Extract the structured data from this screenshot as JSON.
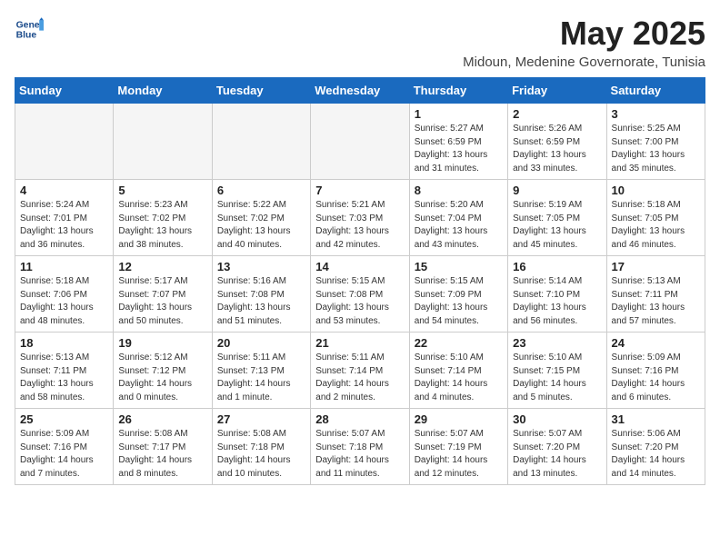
{
  "header": {
    "logo_line1": "General",
    "logo_line2": "Blue",
    "month": "May 2025",
    "location": "Midoun, Medenine Governorate, Tunisia"
  },
  "weekdays": [
    "Sunday",
    "Monday",
    "Tuesday",
    "Wednesday",
    "Thursday",
    "Friday",
    "Saturday"
  ],
  "rows": [
    [
      {
        "day": "",
        "info": "",
        "empty": true
      },
      {
        "day": "",
        "info": "",
        "empty": true
      },
      {
        "day": "",
        "info": "",
        "empty": true
      },
      {
        "day": "",
        "info": "",
        "empty": true
      },
      {
        "day": "1",
        "info": "Sunrise: 5:27 AM\nSunset: 6:59 PM\nDaylight: 13 hours\nand 31 minutes.",
        "empty": false
      },
      {
        "day": "2",
        "info": "Sunrise: 5:26 AM\nSunset: 6:59 PM\nDaylight: 13 hours\nand 33 minutes.",
        "empty": false
      },
      {
        "day": "3",
        "info": "Sunrise: 5:25 AM\nSunset: 7:00 PM\nDaylight: 13 hours\nand 35 minutes.",
        "empty": false
      }
    ],
    [
      {
        "day": "4",
        "info": "Sunrise: 5:24 AM\nSunset: 7:01 PM\nDaylight: 13 hours\nand 36 minutes.",
        "empty": false
      },
      {
        "day": "5",
        "info": "Sunrise: 5:23 AM\nSunset: 7:02 PM\nDaylight: 13 hours\nand 38 minutes.",
        "empty": false
      },
      {
        "day": "6",
        "info": "Sunrise: 5:22 AM\nSunset: 7:02 PM\nDaylight: 13 hours\nand 40 minutes.",
        "empty": false
      },
      {
        "day": "7",
        "info": "Sunrise: 5:21 AM\nSunset: 7:03 PM\nDaylight: 13 hours\nand 42 minutes.",
        "empty": false
      },
      {
        "day": "8",
        "info": "Sunrise: 5:20 AM\nSunset: 7:04 PM\nDaylight: 13 hours\nand 43 minutes.",
        "empty": false
      },
      {
        "day": "9",
        "info": "Sunrise: 5:19 AM\nSunset: 7:05 PM\nDaylight: 13 hours\nand 45 minutes.",
        "empty": false
      },
      {
        "day": "10",
        "info": "Sunrise: 5:18 AM\nSunset: 7:05 PM\nDaylight: 13 hours\nand 46 minutes.",
        "empty": false
      }
    ],
    [
      {
        "day": "11",
        "info": "Sunrise: 5:18 AM\nSunset: 7:06 PM\nDaylight: 13 hours\nand 48 minutes.",
        "empty": false
      },
      {
        "day": "12",
        "info": "Sunrise: 5:17 AM\nSunset: 7:07 PM\nDaylight: 13 hours\nand 50 minutes.",
        "empty": false
      },
      {
        "day": "13",
        "info": "Sunrise: 5:16 AM\nSunset: 7:08 PM\nDaylight: 13 hours\nand 51 minutes.",
        "empty": false
      },
      {
        "day": "14",
        "info": "Sunrise: 5:15 AM\nSunset: 7:08 PM\nDaylight: 13 hours\nand 53 minutes.",
        "empty": false
      },
      {
        "day": "15",
        "info": "Sunrise: 5:15 AM\nSunset: 7:09 PM\nDaylight: 13 hours\nand 54 minutes.",
        "empty": false
      },
      {
        "day": "16",
        "info": "Sunrise: 5:14 AM\nSunset: 7:10 PM\nDaylight: 13 hours\nand 56 minutes.",
        "empty": false
      },
      {
        "day": "17",
        "info": "Sunrise: 5:13 AM\nSunset: 7:11 PM\nDaylight: 13 hours\nand 57 minutes.",
        "empty": false
      }
    ],
    [
      {
        "day": "18",
        "info": "Sunrise: 5:13 AM\nSunset: 7:11 PM\nDaylight: 13 hours\nand 58 minutes.",
        "empty": false
      },
      {
        "day": "19",
        "info": "Sunrise: 5:12 AM\nSunset: 7:12 PM\nDaylight: 14 hours\nand 0 minutes.",
        "empty": false
      },
      {
        "day": "20",
        "info": "Sunrise: 5:11 AM\nSunset: 7:13 PM\nDaylight: 14 hours\nand 1 minute.",
        "empty": false
      },
      {
        "day": "21",
        "info": "Sunrise: 5:11 AM\nSunset: 7:14 PM\nDaylight: 14 hours\nand 2 minutes.",
        "empty": false
      },
      {
        "day": "22",
        "info": "Sunrise: 5:10 AM\nSunset: 7:14 PM\nDaylight: 14 hours\nand 4 minutes.",
        "empty": false
      },
      {
        "day": "23",
        "info": "Sunrise: 5:10 AM\nSunset: 7:15 PM\nDaylight: 14 hours\nand 5 minutes.",
        "empty": false
      },
      {
        "day": "24",
        "info": "Sunrise: 5:09 AM\nSunset: 7:16 PM\nDaylight: 14 hours\nand 6 minutes.",
        "empty": false
      }
    ],
    [
      {
        "day": "25",
        "info": "Sunrise: 5:09 AM\nSunset: 7:16 PM\nDaylight: 14 hours\nand 7 minutes.",
        "empty": false
      },
      {
        "day": "26",
        "info": "Sunrise: 5:08 AM\nSunset: 7:17 PM\nDaylight: 14 hours\nand 8 minutes.",
        "empty": false
      },
      {
        "day": "27",
        "info": "Sunrise: 5:08 AM\nSunset: 7:18 PM\nDaylight: 14 hours\nand 10 minutes.",
        "empty": false
      },
      {
        "day": "28",
        "info": "Sunrise: 5:07 AM\nSunset: 7:18 PM\nDaylight: 14 hours\nand 11 minutes.",
        "empty": false
      },
      {
        "day": "29",
        "info": "Sunrise: 5:07 AM\nSunset: 7:19 PM\nDaylight: 14 hours\nand 12 minutes.",
        "empty": false
      },
      {
        "day": "30",
        "info": "Sunrise: 5:07 AM\nSunset: 7:20 PM\nDaylight: 14 hours\nand 13 minutes.",
        "empty": false
      },
      {
        "day": "31",
        "info": "Sunrise: 5:06 AM\nSunset: 7:20 PM\nDaylight: 14 hours\nand 14 minutes.",
        "empty": false
      }
    ]
  ]
}
